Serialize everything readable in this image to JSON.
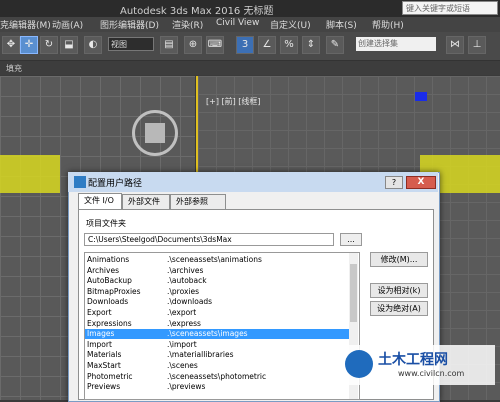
{
  "window": {
    "title": "Autodesk 3ds Max 2016    无标题"
  },
  "search": {
    "placeholder": "键入关键字或短语"
  },
  "menu": [
    "克编辑器(M)",
    "动画(A)",
    "图形编辑器(D)",
    "渲染(R)",
    "Civil View",
    "自定义(U)",
    "脚本(S)",
    "帮助(H)"
  ],
  "toolbar": {
    "view_select": "视图",
    "selection_set": "创建选择集",
    "snap_label": "3",
    "ribbon_label": "填充"
  },
  "viewport": {
    "label": "[+] [前] [线框]"
  },
  "dialog": {
    "title": "配置用户路径",
    "help_label": "?",
    "close_label": "X",
    "tabs": [
      "文件 I/O",
      "外部文件",
      "外部参照"
    ],
    "project_folder_label": "项目文件夹",
    "project_path": "C:\\Users\\Steelgod\\Documents\\3dsMax",
    "browse_label": "...",
    "entries": [
      {
        "name": "Animations",
        "path": ".\\sceneassets\\animations"
      },
      {
        "name": "Archives",
        "path": ".\\archives"
      },
      {
        "name": "AutoBackup",
        "path": ".\\autoback"
      },
      {
        "name": "BitmapProxies",
        "path": ".\\proxies"
      },
      {
        "name": "Downloads",
        "path": ".\\downloads"
      },
      {
        "name": "Export",
        "path": ".\\export"
      },
      {
        "name": "Expressions",
        "path": ".\\express"
      },
      {
        "name": "Images",
        "path": ".\\sceneassets\\images"
      },
      {
        "name": "Import",
        "path": ".\\import"
      },
      {
        "name": "Materials",
        "path": ".\\materiallibraries"
      },
      {
        "name": "MaxStart",
        "path": ".\\scenes"
      },
      {
        "name": "Photometric",
        "path": ".\\sceneassets\\photometric"
      },
      {
        "name": "Previews",
        "path": ".\\previews"
      }
    ],
    "selected_index": 7,
    "buttons": {
      "modify": "修改(M)...",
      "make_relative": "设为相对(k)",
      "make_absolute": "设为绝对(A)"
    }
  },
  "watermark": {
    "name": "土木工程网",
    "url": "www.civilcn.com"
  }
}
